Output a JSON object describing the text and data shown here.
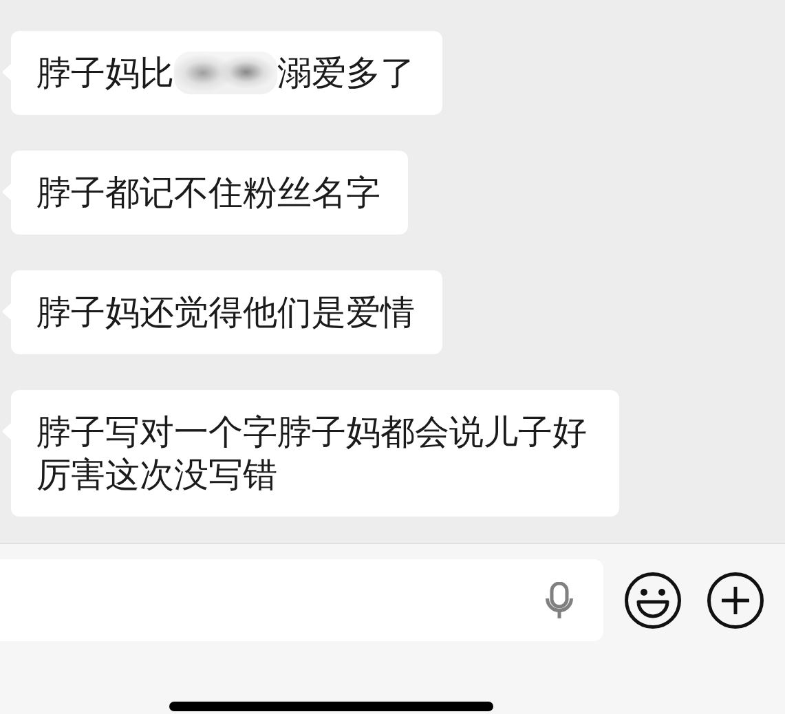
{
  "messages": [
    {
      "parts": [
        {
          "kind": "text",
          "text": "脖子妈比"
        },
        {
          "kind": "blur"
        },
        {
          "kind": "text",
          "text": "溺爱多了"
        }
      ]
    },
    {
      "parts": [
        {
          "kind": "text",
          "text": "脖子都记不住粉丝名字"
        }
      ]
    },
    {
      "parts": [
        {
          "kind": "text",
          "text": "脖子妈还觉得他们是爱情"
        }
      ]
    },
    {
      "parts": [
        {
          "kind": "text",
          "text": "脖子写对一个字脖子妈都会说儿子好厉害这次没写错"
        }
      ]
    }
  ]
}
